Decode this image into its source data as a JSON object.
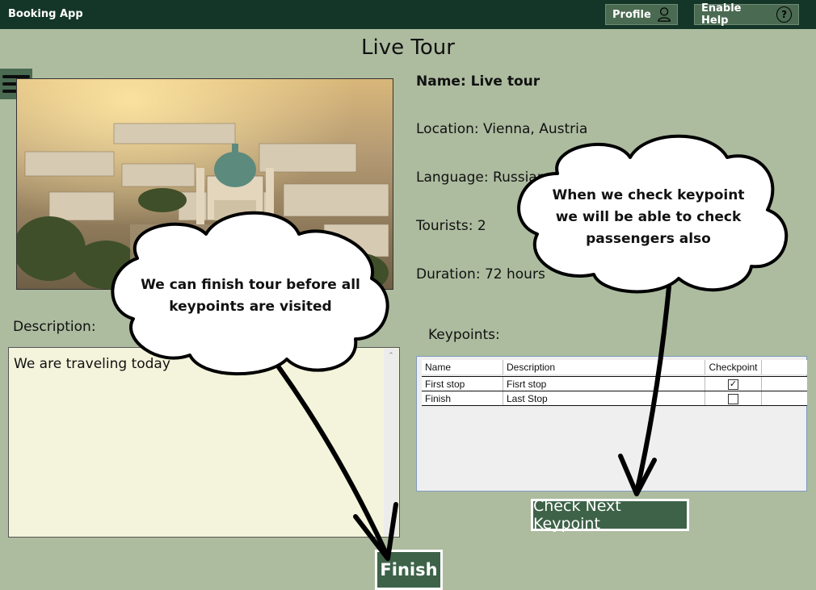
{
  "app": {
    "title": "Booking App"
  },
  "header": {
    "profile_label": "Profile",
    "help_label": "Enable Help",
    "help_icon": "?"
  },
  "page": {
    "title": "Live Tour"
  },
  "tour": {
    "name": "Name: Live tour",
    "location": "Location: Vienna, Austria",
    "language": "Language: Russian",
    "tourists": "Tourists: 2",
    "duration": "Duration: 72 hours"
  },
  "description": {
    "label": "Description:",
    "value": "We are traveling today"
  },
  "keypoints": {
    "label": "Keypoints:",
    "columns": [
      "Name",
      "Description",
      "Checkpoint"
    ],
    "rows": [
      {
        "name": "First stop",
        "description": "Fisrt stop",
        "checked": "✓"
      },
      {
        "name": "Finish",
        "description": "Last Stop",
        "checked": ""
      }
    ]
  },
  "buttons": {
    "check_next": "Check Next Keypoint",
    "finish": "Finish"
  },
  "annotations": {
    "left": [
      "We can finish tour before all",
      "keypoints are visited"
    ],
    "right": [
      "When we check keypoint",
      "we will be able to check",
      "passengers also"
    ]
  },
  "colors": {
    "background": "#adbc9f",
    "titlebar": "#143628",
    "button": "#3d6248",
    "description_bg": "#f4f4dc"
  }
}
